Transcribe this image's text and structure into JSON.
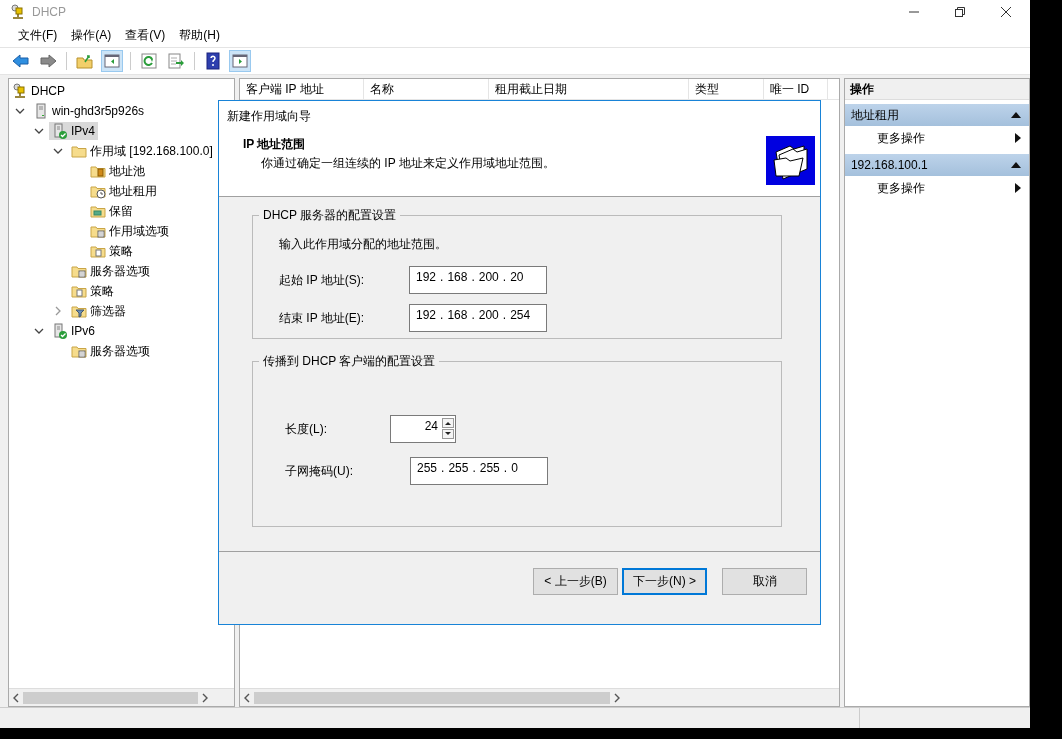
{
  "window": {
    "title": "DHCP"
  },
  "menu": [
    {
      "label": "文件(F)"
    },
    {
      "label": "操作(A)"
    },
    {
      "label": "查看(V)"
    },
    {
      "label": "帮助(H)"
    }
  ],
  "toolbar": [
    {
      "kind": "back",
      "on": false,
      "disabled": false
    },
    {
      "kind": "forward",
      "on": false,
      "disabled": true
    },
    {
      "kind": "sep"
    },
    {
      "kind": "up",
      "on": false,
      "disabled": false
    },
    {
      "kind": "tree",
      "on": true,
      "disabled": false
    },
    {
      "kind": "sep"
    },
    {
      "kind": "refresh",
      "on": false,
      "disabled": false
    },
    {
      "kind": "export",
      "on": false,
      "disabled": false
    },
    {
      "kind": "sep"
    },
    {
      "kind": "help",
      "on": false,
      "disabled": false
    },
    {
      "kind": "actions",
      "on": true,
      "disabled": false
    }
  ],
  "tree": [
    {
      "label": "DHCP",
      "kind": "dhcp",
      "selected": false,
      "children": [
        {
          "label": "win-ghd3r5p926s",
          "kind": "server",
          "expanded": true,
          "selected": false,
          "children": [
            {
              "label": "IPv4",
              "kind": "ip",
              "expanded": true,
              "selected": true,
              "children": [
                {
                  "label": "作用域 [192.168.100.0]",
                  "kind": "folder",
                  "expanded": true,
                  "selected": false,
                  "children": [
                    {
                      "label": "地址池",
                      "kind": "pool",
                      "selected": false
                    },
                    {
                      "label": "地址租用",
                      "kind": "lease",
                      "selected": false
                    },
                    {
                      "label": "保留",
                      "kind": "reservation",
                      "selected": false
                    },
                    {
                      "label": "作用域选项",
                      "kind": "options",
                      "selected": false
                    },
                    {
                      "label": "策略",
                      "kind": "policy",
                      "selected": false
                    }
                  ]
                },
                {
                  "label": "服务器选项",
                  "kind": "options",
                  "selected": false
                },
                {
                  "label": "策略",
                  "kind": "policy",
                  "selected": false
                },
                {
                  "label": "筛选器",
                  "kind": "filter",
                  "expanded": false,
                  "selected": false
                }
              ]
            },
            {
              "label": "IPv6",
              "kind": "ip",
              "expanded": true,
              "selected": false,
              "children": [
                {
                  "label": "服务器选项",
                  "kind": "options",
                  "selected": false
                }
              ]
            }
          ]
        }
      ]
    }
  ],
  "table": {
    "columns": [
      {
        "label": "客户端 IP 地址"
      },
      {
        "label": "名称"
      },
      {
        "label": "租用截止日期"
      },
      {
        "label": "类型"
      },
      {
        "label": "唯一 ID"
      }
    ]
  },
  "actions": {
    "title": "操作",
    "sections": [
      {
        "title": "地址租用",
        "expanded": true,
        "items": [
          {
            "label": "更多操作"
          }
        ]
      },
      {
        "title": "192.168.100.1",
        "expanded": true,
        "items": [
          {
            "label": "更多操作"
          }
        ]
      }
    ]
  },
  "dialog": {
    "title": "新建作用域向导",
    "heading": "IP 地址范围",
    "subtitle": "你通过确定一组连续的 IP 地址来定义作用域地址范围。",
    "groups": [
      {
        "legend": "DHCP 服务器的配置设置",
        "hint": "输入此作用域分配的地址范围。",
        "fields": [
          {
            "kind": "ip",
            "label": "起始 IP 地址(S):",
            "parts": [
              "192",
              ".",
              "168",
              ".",
              "200",
              ".",
              "20"
            ]
          },
          {
            "kind": "ip",
            "label": "结束 IP 地址(E):",
            "parts": [
              "192",
              ".",
              "168",
              ".",
              "200",
              ".",
              "254"
            ]
          }
        ]
      },
      {
        "legend": "传播到 DHCP 客户端的配置设置",
        "fields": [
          {
            "kind": "spin",
            "label": "长度(L):",
            "value": "24"
          },
          {
            "kind": "ip",
            "label": "子网掩码(U):",
            "parts": [
              "255",
              ".",
              "255",
              ".",
              "255",
              ".",
              "0"
            ]
          }
        ]
      }
    ],
    "buttons": [
      {
        "label": "< 上一步(B)",
        "focused": false
      },
      {
        "label": "下一步(N) >",
        "focused": true
      },
      {
        "label": "取消",
        "focused": false
      }
    ]
  }
}
